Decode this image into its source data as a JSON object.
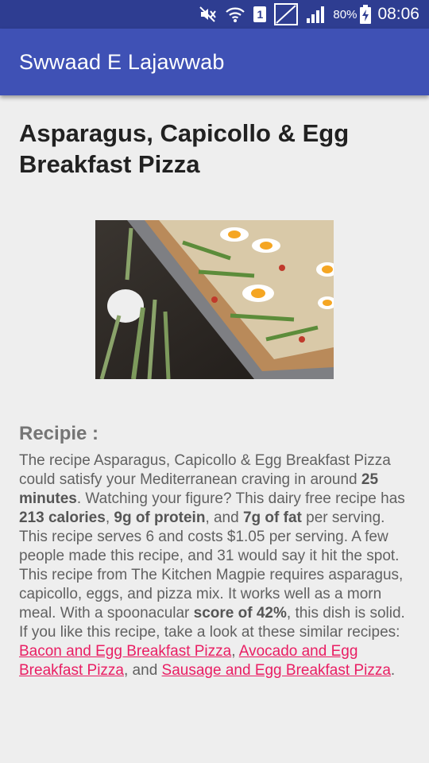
{
  "status_bar": {
    "battery_percent": "80%",
    "time": "08:06",
    "sim_label": "1"
  },
  "app_bar": {
    "title": "Swwaad E Lajawwab"
  },
  "recipe": {
    "title": "Asparagus, Capicollo & Egg Breakfast Pizza",
    "section_heading": "Recipie :",
    "description": {
      "t1": "The recipe Asparagus, Capicollo & Egg Breakfast Pizza could satisfy your Mediterranean craving in around ",
      "b1": "25 minutes",
      "t2": ". Watching your figure? This dairy free recipe has ",
      "b2": "213 calories",
      "t3": ", ",
      "b3": "9g of protein",
      "t4": ", and ",
      "b4": "7g of fat",
      "t5": " per serving. This recipe serves 6 and costs $1.05 per serving. A few people made this recipe, and 31 would say it hit the spot. This recipe from The Kitchen Magpie requires asparagus, capicollo, eggs, and pizza mix. It works well as a morn meal. With a spoonacular ",
      "b5": "score of 42%",
      "t6": ", this dish is solid. If you like this recipe, take a look at these similar recipes: ",
      "link1": "Bacon and Egg Breakfast Pizza",
      "t7": ", ",
      "link2": "Avocado and Egg Breakfast Pizza",
      "t8": ", and ",
      "link3": "Sausage and Egg Breakfast Pizza",
      "t9": "."
    }
  },
  "colors": {
    "status_bar": "#2e3d91",
    "app_bar": "#3f51b5",
    "link": "#e91e63",
    "background": "#eeeeee"
  },
  "icons": [
    "mute-icon",
    "wifi-icon",
    "sim-icon",
    "no-signal-icon",
    "signal-icon",
    "battery-charging-icon"
  ]
}
